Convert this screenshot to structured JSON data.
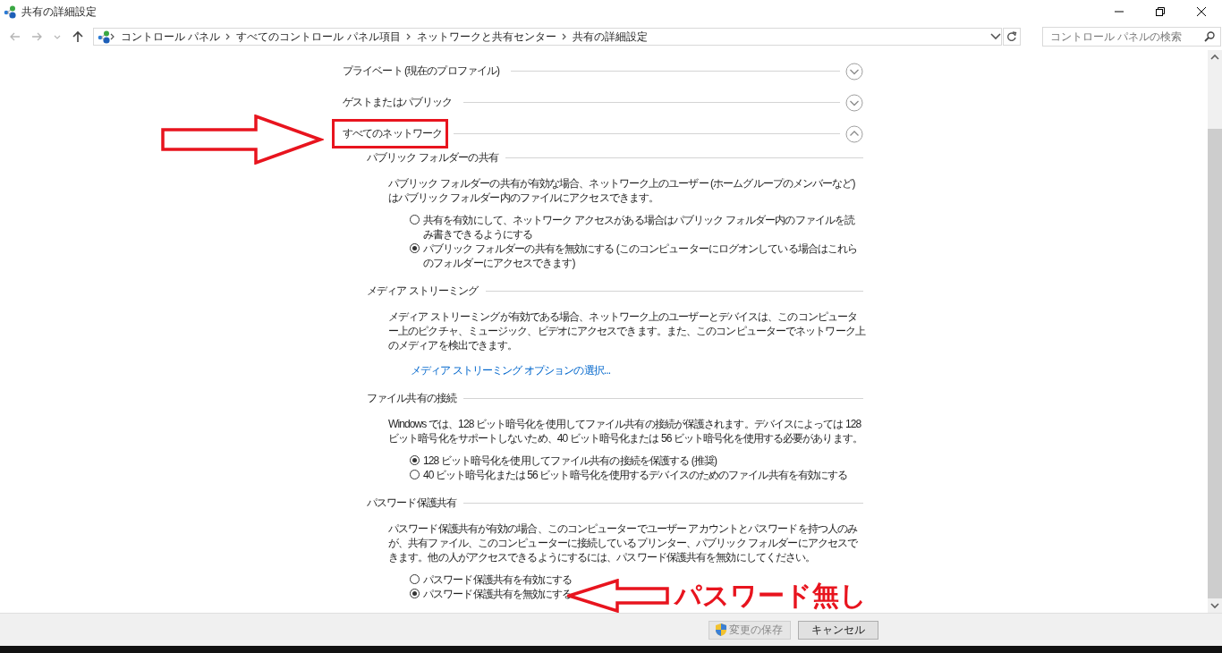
{
  "window": {
    "title": "共有の詳細設定"
  },
  "address_bar": {
    "breadcrumbs": [
      "コントロール パネル",
      "すべてのコントロール パネル項目",
      "ネットワークと共有センター",
      "共有の詳細設定"
    ]
  },
  "search": {
    "placeholder": "コントロール パネルの検索"
  },
  "profiles": [
    {
      "title": "プライベート (現在のプロファイル)",
      "expanded": false,
      "highlighted": false
    },
    {
      "title": "ゲストまたはパブリック",
      "expanded": false,
      "highlighted": false
    },
    {
      "title": "すべてのネットワーク",
      "expanded": true,
      "highlighted": true,
      "sections": [
        {
          "heading": "パブリック フォルダーの共有",
          "description": "パブリック フォルダーの共有が有効な場合、ネットワーク上のユーザー (ホームグループのメンバーなど) はパブリック フォルダー内のファイルにアクセスできます。",
          "options": [
            {
              "label": "共有を有効にして、ネットワーク アクセスがある場合はパブリック フォルダー内のファイルを読み書きできるようにする",
              "selected": false
            },
            {
              "label": "パブリック フォルダーの共有を無効にする (このコンピューターにログオンしている場合はこれらのフォルダーにアクセスできます)",
              "selected": true
            }
          ]
        },
        {
          "heading": "メディア ストリーミング",
          "description": "メディア ストリーミングが有効である場合、ネットワーク上のユーザーとデバイスは、このコンピューター上のピクチャ、ミュージック、ビデオにアクセスできます。また、このコンピューターでネットワーク上のメディアを検出できます。",
          "link": "メディア ストリーミング オプションの選択..."
        },
        {
          "heading": "ファイル共有の接続",
          "description": "Windows では、128 ビット暗号化を使用してファイル共有の接続が保護されます。デバイスによっては 128 ビット暗号化をサポートしないため、40 ビット暗号化または 56 ビット暗号化を使用する必要があります。",
          "options": [
            {
              "label": "128 ビット暗号化を使用してファイル共有の接続を保護する (推奨)",
              "selected": true
            },
            {
              "label": "40 ビット暗号化または 56 ビット暗号化を使用するデバイスのためのファイル共有を有効にする",
              "selected": false
            }
          ]
        },
        {
          "heading": "パスワード保護共有",
          "description": "パスワード保護共有が有効の場合、このコンピューターでユーザー アカウントとパスワードを持つ人のみが、共有ファイル、このコンピューターに接続しているプリンター、パブリック フォルダーにアクセスできます。他の人がアクセスできるようにするには、パスワード保護共有を無効にしてください。",
          "options": [
            {
              "label": "パスワード保護共有を有効にする",
              "selected": false
            },
            {
              "label": "パスワード保護共有を無効にする",
              "selected": true
            }
          ]
        }
      ]
    }
  ],
  "footer": {
    "buttons": [
      {
        "label": "変更の保存",
        "disabled": true,
        "kind": "shield"
      },
      {
        "label": "キャンセル",
        "disabled": false,
        "kind": "plain"
      }
    ]
  },
  "annotation": {
    "note": "パスワード無し"
  }
}
